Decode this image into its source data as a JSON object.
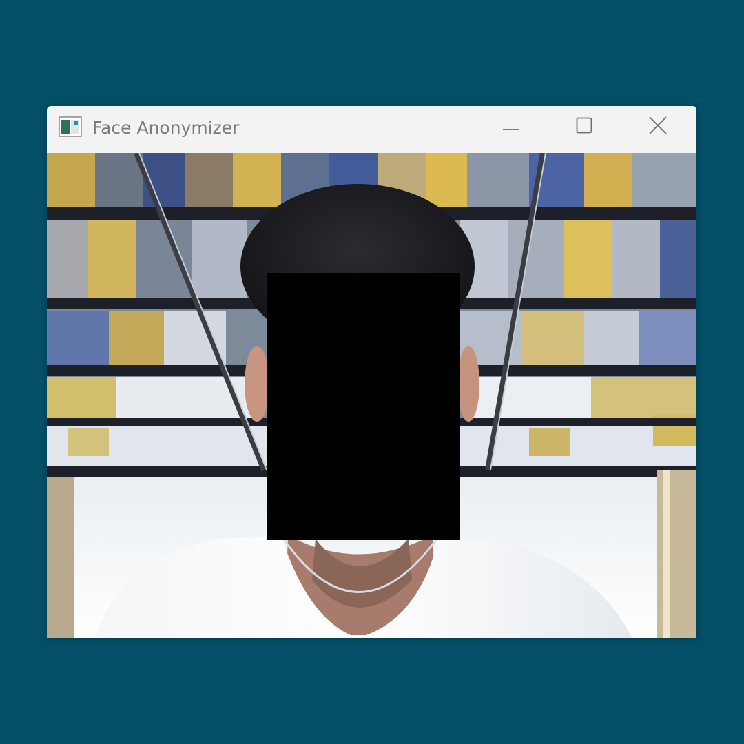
{
  "window": {
    "title": "Face Anonymizer"
  },
  "controls": {
    "minimize_icon": "minimize-icon",
    "maximize_icon": "maximize-icon",
    "close_icon": "close-icon"
  },
  "colors": {
    "desktop_background": "#034f66",
    "titlebar": "#f3f3f3",
    "title_text": "#7b7b7b",
    "face_mask": "#000000"
  }
}
